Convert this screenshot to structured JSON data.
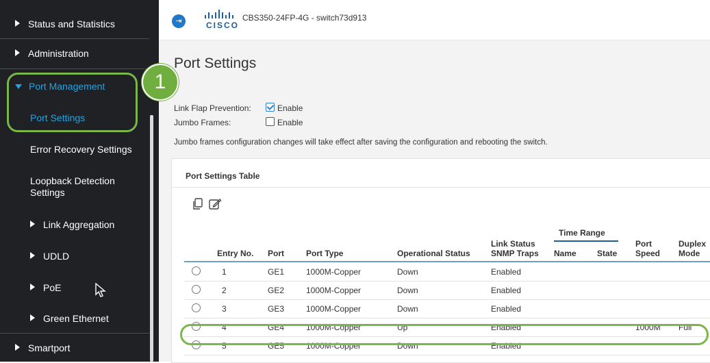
{
  "sidebar": {
    "items": {
      "status": "Status and Statistics",
      "administration": "Administration",
      "port_management": "Port Management",
      "port_settings": "Port Settings",
      "error_recovery": "Error Recovery Settings",
      "loopback_line1": "Loopback Detection",
      "loopback_line2": "Settings",
      "link_aggregation": "Link Aggregation",
      "udld": "UDLD",
      "poe": "PoE",
      "green_ethernet": "Green Ethernet",
      "smartport": "Smartport"
    },
    "badge": "1"
  },
  "header": {
    "logo_text": "CISCO",
    "device_name": "CBS350-24FP-4G - switch73d913",
    "toggle_icon": "sidebar-toggle-icon"
  },
  "main": {
    "title": "Port Settings",
    "link_flap_label": "Link Flap Prevention:",
    "link_flap_value": "Enable",
    "jumbo_label": "Jumbo Frames:",
    "jumbo_value": "Enable",
    "jumbo_note": "Jumbo frames configuration changes will take effect after saving the configuration and rebooting the switch.",
    "link_flap_checked": true,
    "jumbo_checked": false
  },
  "table": {
    "title": "Port Settings Table",
    "headers": {
      "entry_no": "Entry No.",
      "port": "Port",
      "port_type": "Port Type",
      "operational_status": "Operational Status",
      "link_status_1": "Link Status",
      "link_status_2": "SNMP Traps",
      "time_range": "Time Range",
      "name": "Name",
      "state": "State",
      "port_speed_1": "Port",
      "port_speed_2": "Speed",
      "duplex_1": "Duplex",
      "duplex_2": "Mode"
    },
    "rows": [
      {
        "entry": "1",
        "port": "GE1",
        "type": "1000M-Copper",
        "status": "Down",
        "traps": "Enabled",
        "speed": "",
        "duplex": ""
      },
      {
        "entry": "2",
        "port": "GE2",
        "type": "1000M-Copper",
        "status": "Down",
        "traps": "Enabled",
        "speed": "",
        "duplex": ""
      },
      {
        "entry": "3",
        "port": "GE3",
        "type": "1000M-Copper",
        "status": "Down",
        "traps": "Enabled",
        "speed": "",
        "duplex": ""
      },
      {
        "entry": "4",
        "port": "GE4",
        "type": "1000M-Copper",
        "status": "Up",
        "traps": "Enabled",
        "speed": "1000M",
        "duplex": "Full"
      },
      {
        "entry": "5",
        "port": "GE5",
        "type": "1000M-Copper",
        "status": "Down",
        "traps": "Enabled",
        "speed": "",
        "duplex": ""
      }
    ]
  },
  "colors": {
    "sidebar_bg": "#1f2124",
    "active_blue": "#22a3e6",
    "highlight_green": "#7ab648",
    "content_bg": "#f3f3f3"
  }
}
